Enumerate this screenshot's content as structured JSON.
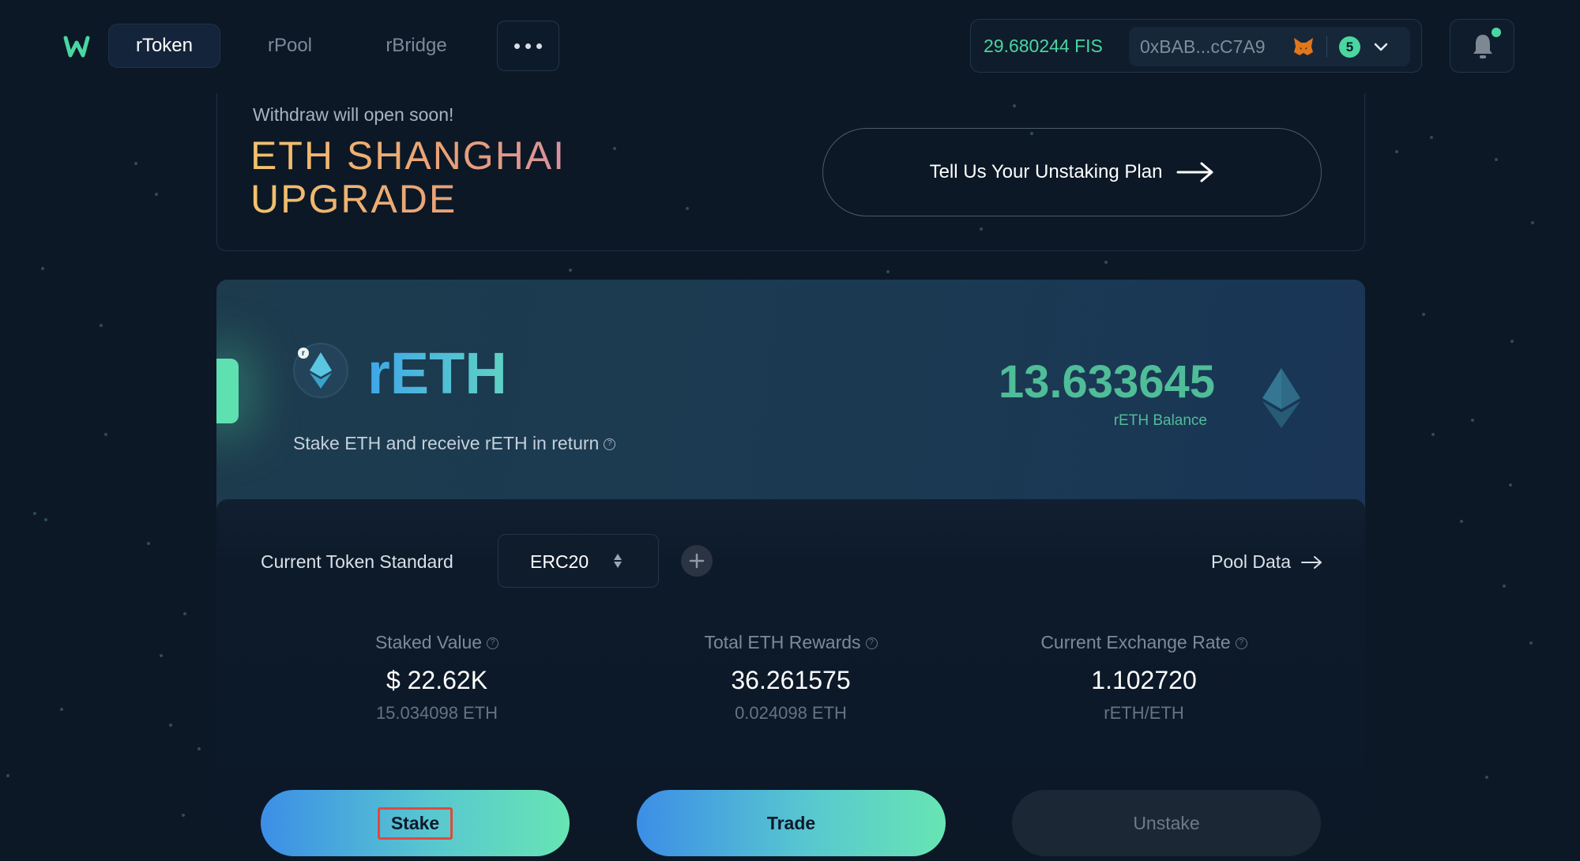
{
  "nav": {
    "tabs": [
      {
        "label": "rToken",
        "active": true
      },
      {
        "label": "rPool",
        "active": false
      },
      {
        "label": "rBridge",
        "active": false
      }
    ]
  },
  "wallet": {
    "fis_balance": "29.680244 FIS",
    "address": "0xBAB...cC7A9",
    "notification_count": "5"
  },
  "banner": {
    "subtitle": "Withdraw will open soon!",
    "title_line1": "ETH SHANGHAI",
    "title_line2": "UPGRADE",
    "cta_label": "Tell Us Your Unstaking Plan"
  },
  "token": {
    "badge": "r",
    "name": "rETH",
    "description": "Stake ETH and receive rETH in return",
    "balance": "13.633645",
    "balance_label": "rETH Balance"
  },
  "panel": {
    "standard_label": "Current Token Standard",
    "standard_value": "ERC20",
    "pool_data_label": "Pool Data",
    "stats": [
      {
        "label": "Staked Value",
        "value": "$ 22.62K",
        "sub": "15.034098 ETH"
      },
      {
        "label": "Total ETH Rewards",
        "value": "36.261575",
        "sub": "0.024098 ETH"
      },
      {
        "label": "Current Exchange Rate",
        "value": "1.102720",
        "sub": "rETH/ETH"
      }
    ],
    "actions": {
      "stake": "Stake",
      "trade": "Trade",
      "unstake": "Unstake"
    }
  },
  "colors": {
    "background": "#0c1826",
    "accent_green": "#4ad6a0",
    "balance_green": "#4fbd98",
    "highlight_red": "#e0493e"
  },
  "icons": [
    "logo-icon",
    "more-icon",
    "metamask-icon",
    "chevron-down-icon",
    "bell-icon",
    "arrow-right-icon",
    "eth-icon",
    "help-icon",
    "sort-icon",
    "plus-icon"
  ]
}
